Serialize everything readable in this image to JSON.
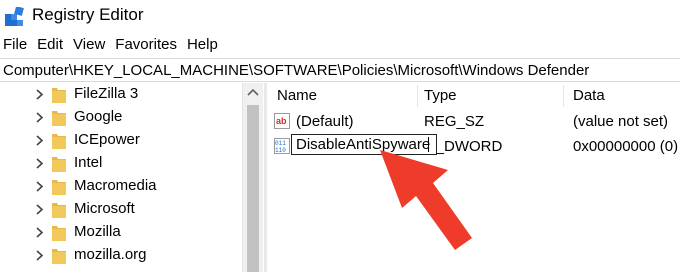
{
  "window": {
    "title": "Registry Editor"
  },
  "menu": [
    "File",
    "Edit",
    "View",
    "Favorites",
    "Help"
  ],
  "address": "Computer\\HKEY_LOCAL_MACHINE\\SOFTWARE\\Policies\\Microsoft\\Windows Defender",
  "tree": {
    "items": [
      "FileZilla 3",
      "Google",
      "ICEpower",
      "Intel",
      "Macromedia",
      "Microsoft",
      "Mozilla",
      "mozilla.org"
    ]
  },
  "list": {
    "columns": [
      "Name",
      "Type",
      "Data"
    ],
    "rows": [
      {
        "icon": "string-value-icon",
        "name": "(Default)",
        "type": "REG_SZ",
        "data": "(value not set)"
      },
      {
        "icon": "dword-value-icon",
        "name": "",
        "type": "G_DWORD",
        "data": "0x00000000 (0)"
      }
    ],
    "edit_value": "DisableAntiSpyware"
  },
  "annotation": {
    "color": "#ee3b2a",
    "shape": "arrow-pointing-to-rename-field"
  },
  "colors": {
    "folder": "#e8b84a",
    "icon_blue": "#1e6fd0",
    "string_icon_red": "#cc2f2f"
  }
}
